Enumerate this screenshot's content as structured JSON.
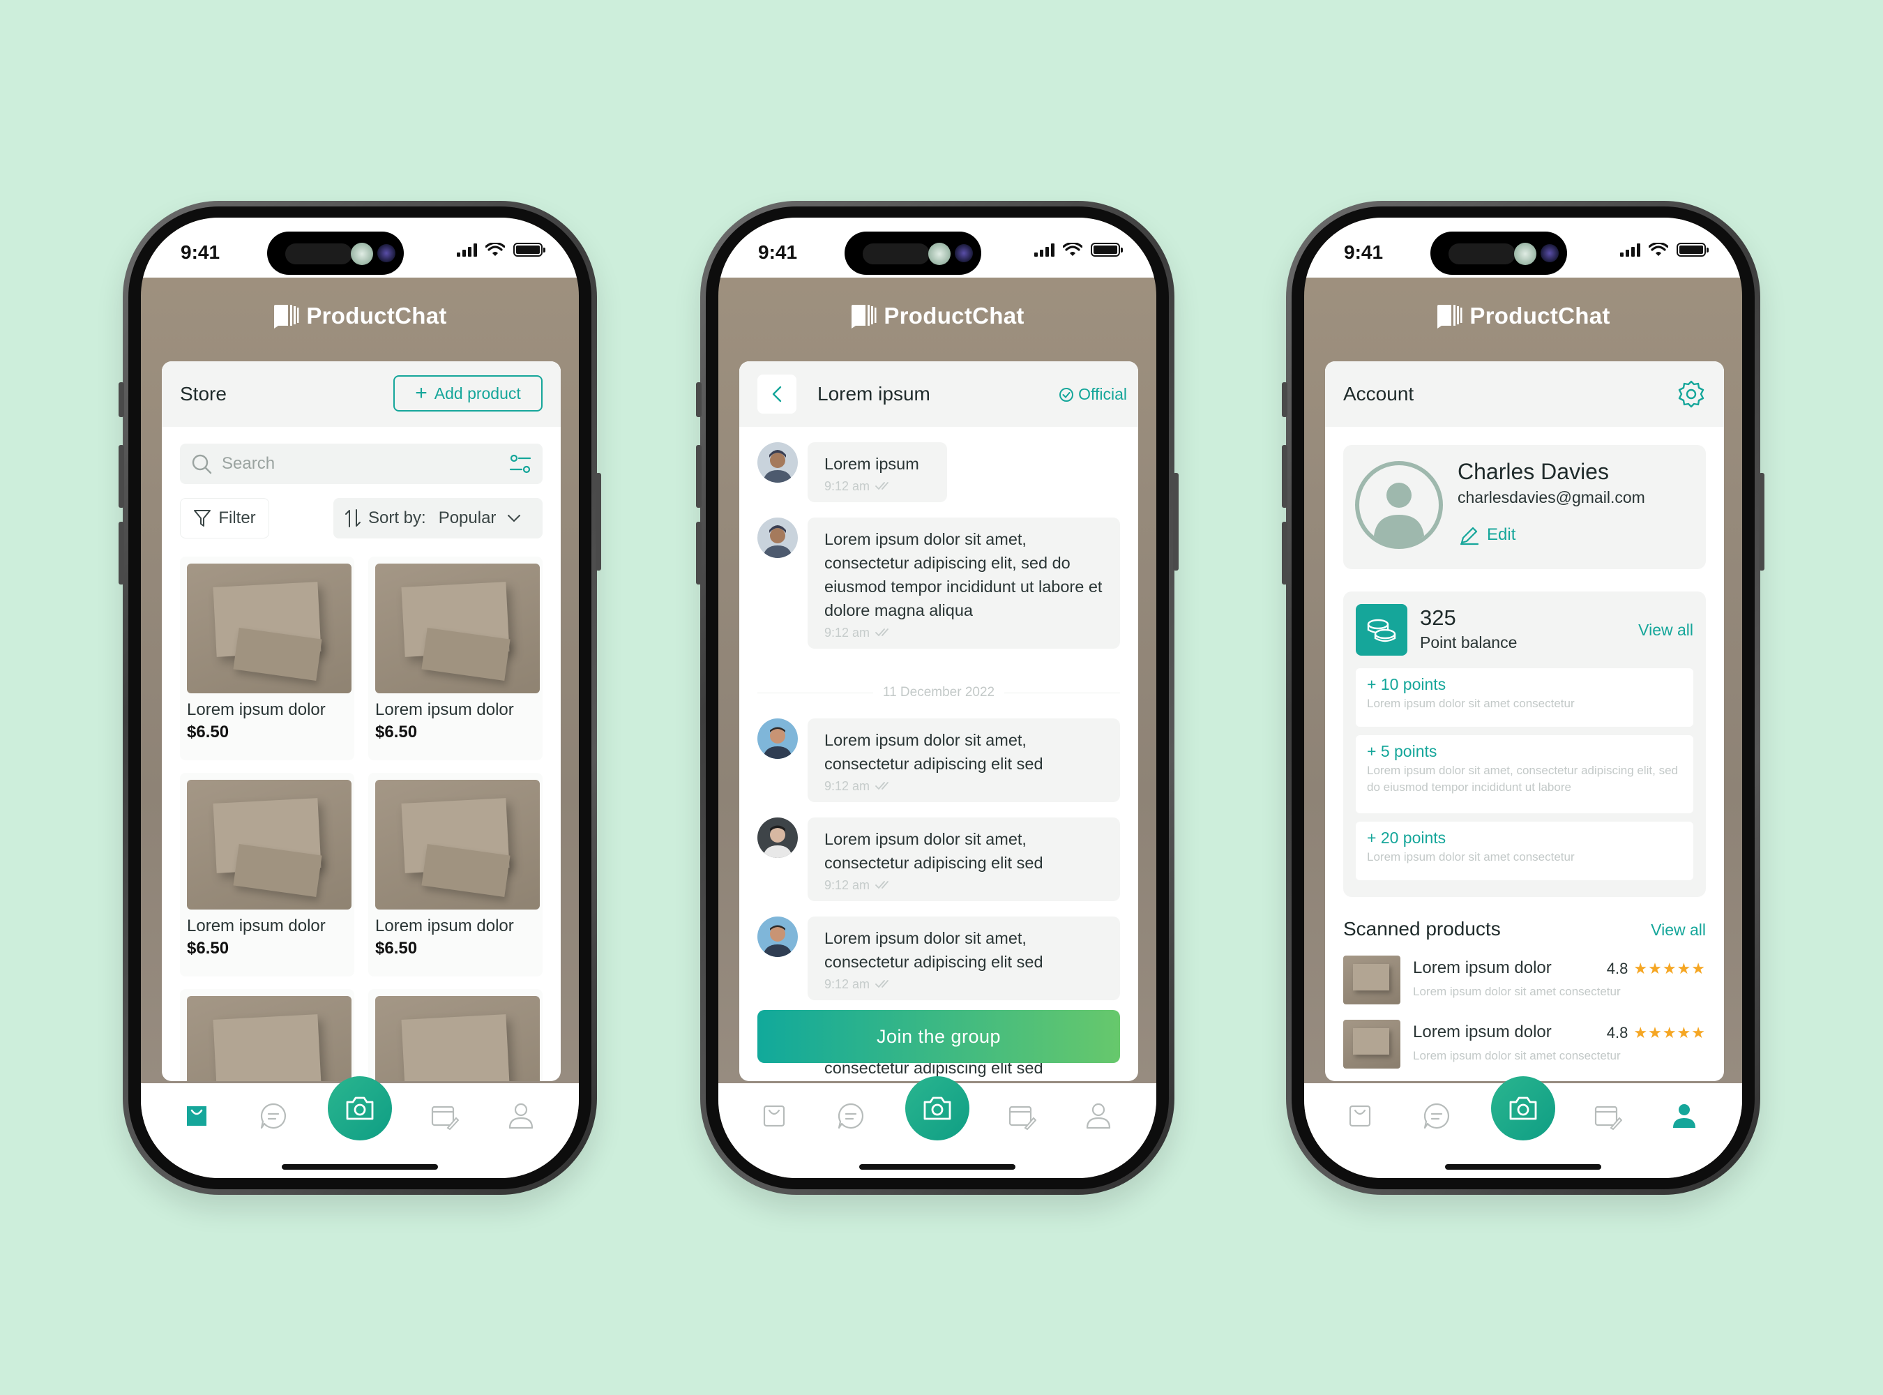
{
  "status": {
    "time": "9:41"
  },
  "brand": {
    "name": "ProductChat"
  },
  "colors": {
    "accent": "#15a69a",
    "background": "#cdeedb",
    "star": "#f5a623"
  },
  "store": {
    "title": "Store",
    "add_button": "Add product",
    "search_placeholder": "Search",
    "filter_label": "Filter",
    "sort_label": "Sort by:",
    "sort_value": "Popular",
    "products": [
      {
        "name": "Lorem ipsum dolor",
        "price": "$6.50"
      },
      {
        "name": "Lorem ipsum dolor",
        "price": "$6.50"
      },
      {
        "name": "Lorem ipsum dolor",
        "price": "$6.50"
      },
      {
        "name": "Lorem ipsum dolor",
        "price": "$6.50"
      }
    ]
  },
  "chat": {
    "title": "Lorem ipsum",
    "badge": "Official",
    "date_separator": "11 December 2022",
    "messages": [
      {
        "text": "Lorem ipsum",
        "time": "9:12 am"
      },
      {
        "text": "Lorem ipsum dolor sit amet, consectetur adipiscing elit, sed do eiusmod tempor incididunt ut labore et dolore magna aliqua",
        "time": "9:12 am"
      },
      {
        "text": "Lorem ipsum dolor sit amet, consectetur adipiscing elit sed",
        "time": "9:12 am"
      },
      {
        "text": "Lorem ipsum dolor sit amet, consectetur adipiscing elit sed",
        "time": "9:12 am"
      },
      {
        "text": "Lorem ipsum dolor sit amet, consectetur adipiscing elit sed",
        "time": "9:12 am"
      }
    ],
    "partial_message": "consectetur adipiscing elit sed",
    "join_button": "Join the group"
  },
  "account": {
    "title": "Account",
    "name": "Charles Davies",
    "email": "charlesdavies@gmail.com",
    "edit_label": "Edit",
    "points_value": "325",
    "points_label": "Point balance",
    "points_view_all": "View all",
    "point_items": [
      {
        "title": "+ 10 points",
        "desc": "Lorem ipsum dolor sit amet consectetur"
      },
      {
        "title": "+ 5 points",
        "desc": "Lorem ipsum dolor sit amet, consectetur adipiscing elit, sed do eiusmod tempor incididunt ut labore"
      },
      {
        "title": "+ 20 points",
        "desc": "Lorem ipsum dolor sit amet consectetur"
      }
    ],
    "scanned_title": "Scanned products",
    "scanned_view_all": "View all",
    "scanned": [
      {
        "name": "Lorem ipsum dolor",
        "desc": "Lorem ipsum dolor sit amet consectetur",
        "rating": "4.8",
        "stars": "★★★★★"
      },
      {
        "name": "Lorem ipsum dolor",
        "desc": "Lorem ipsum dolor sit amet consectetur",
        "rating": "4.8",
        "stars": "★★★★★"
      }
    ]
  },
  "tabs": [
    {
      "icon": "store-bag-icon"
    },
    {
      "icon": "chat-bubble-icon"
    },
    {
      "icon": "camera-icon"
    },
    {
      "icon": "card-edit-icon"
    },
    {
      "icon": "user-icon"
    }
  ]
}
